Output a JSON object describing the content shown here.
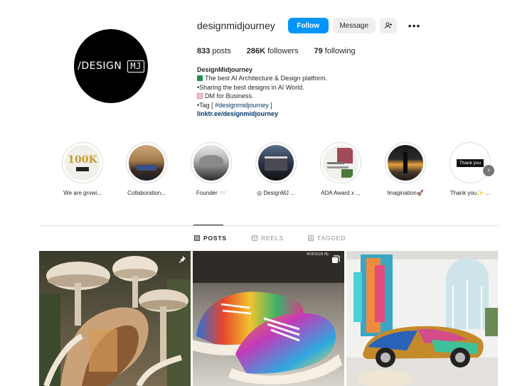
{
  "profile": {
    "username": "designmidjourney",
    "avatar_text_main": "/DESIGN",
    "avatar_text_box": "MJ",
    "follow_label": "Follow",
    "message_label": "Message",
    "stats": [
      {
        "count": "833",
        "label": " posts"
      },
      {
        "count": "286K",
        "label": " followers"
      },
      {
        "count": "79",
        "label": " following"
      }
    ],
    "bio": {
      "name": "DesignMidjourney",
      "line1": "The best AI Architecture & Design platform.",
      "line2": "•Sharing the best designs in AI World.",
      "line3": "DM for Business.",
      "line4_prefix": "•Tag [ ",
      "line4_tag": "#designmidjourney",
      "line4_suffix": " ]",
      "link": "linktr.ee/designmidjourney"
    }
  },
  "highlights": [
    {
      "label": "We are growi...",
      "cover_text": "100K"
    },
    {
      "label": "Collaboration..."
    },
    {
      "label": "Founder 📨"
    },
    {
      "label": "◎ DesignMJ ..."
    },
    {
      "label": "ADA Award x ..."
    },
    {
      "label": "Imagination🚀"
    },
    {
      "label": "Thank you✨ ...",
      "cover_text": "Thank you"
    }
  ],
  "tabs": [
    {
      "label": "POSTS",
      "icon": "grid-icon"
    },
    {
      "label": "REELS",
      "icon": "reels-icon"
    },
    {
      "label": "TAGGED",
      "icon": "tagged-icon"
    }
  ],
  "posts": [
    {
      "alt": "mushroom house",
      "badge": "pin-icon"
    },
    {
      "alt": "colorful sneakers",
      "badge": "multi-image-icon",
      "watermark": "#DESIGN MJ"
    },
    {
      "alt": "painted sports car"
    }
  ],
  "colors": {
    "accent": "#0095f6",
    "button_gray": "#efefef",
    "text": "#262626",
    "muted": "#8e8e8e",
    "link": "#00376b"
  }
}
